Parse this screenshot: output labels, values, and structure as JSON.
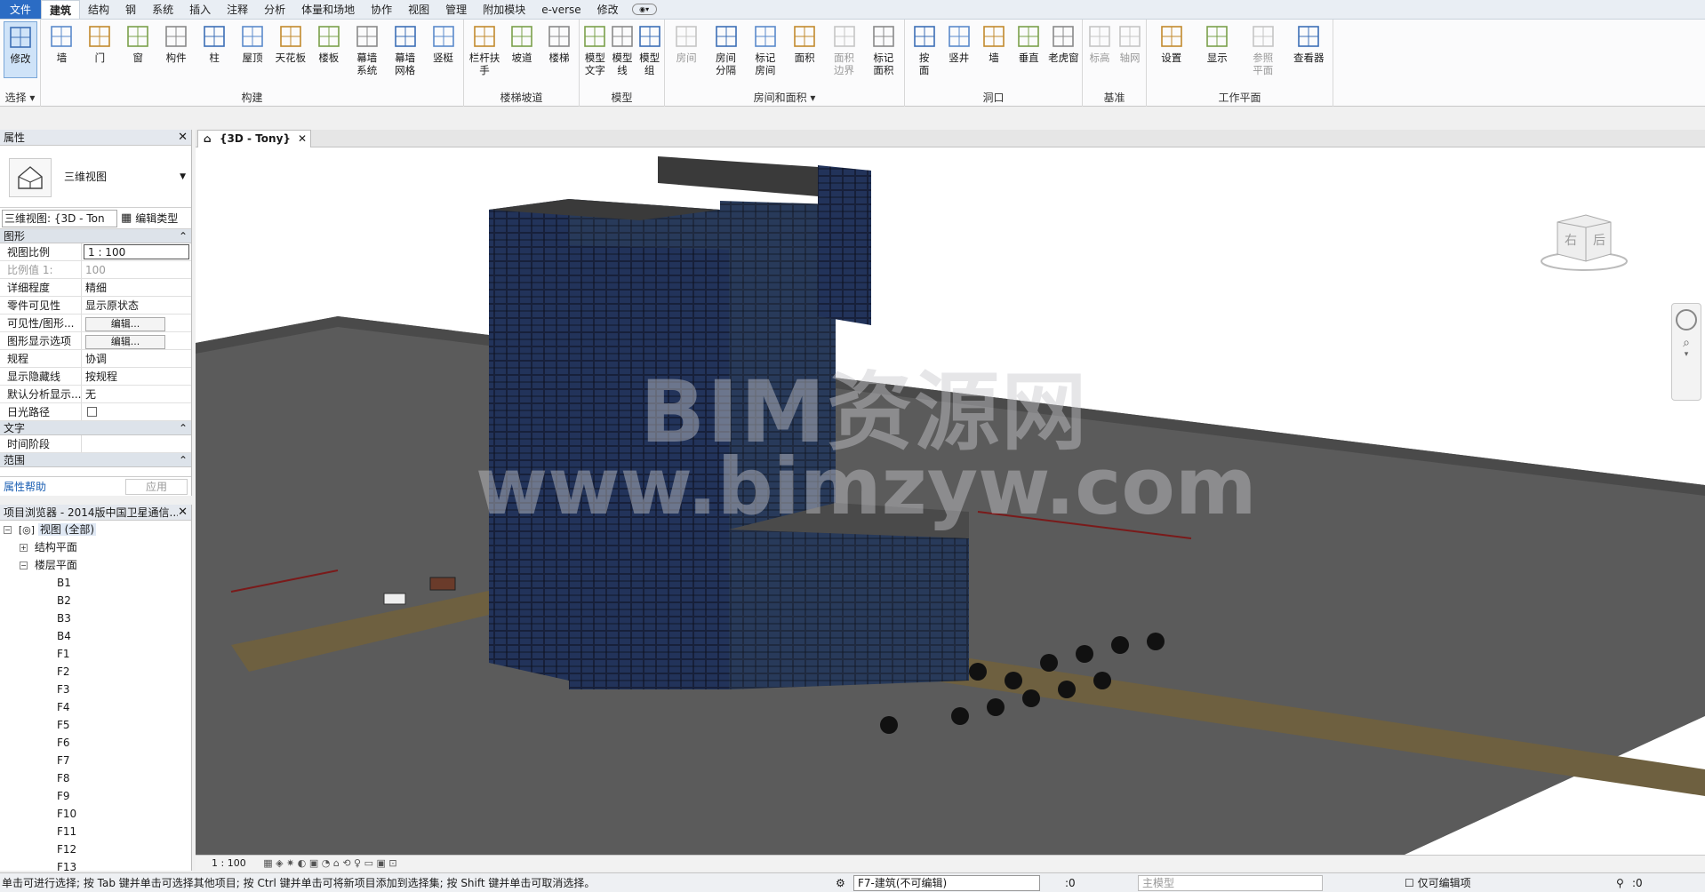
{
  "menu": {
    "tabs": [
      "文件",
      "建筑",
      "结构",
      "钢",
      "系统",
      "插入",
      "注释",
      "分析",
      "体量和场地",
      "协作",
      "视图",
      "管理",
      "附加模块",
      "e-verse",
      "修改"
    ],
    "active": "建筑"
  },
  "ribbon": {
    "panels": [
      {
        "label": "选择 ▾",
        "buttons": [
          {
            "label": "修改"
          }
        ]
      },
      {
        "label": "构建",
        "buttons": [
          {
            "label": "墙"
          },
          {
            "label": "门"
          },
          {
            "label": "窗"
          },
          {
            "label": "构件"
          },
          {
            "label": "柱"
          },
          {
            "label": "屋顶"
          },
          {
            "label": "天花板"
          },
          {
            "label": "楼板"
          },
          {
            "label": "幕墙\n系统"
          },
          {
            "label": "幕墙\n网格"
          },
          {
            "label": "竖梃"
          }
        ]
      },
      {
        "label": "楼梯坡道",
        "buttons": [
          {
            "label": "栏杆扶手"
          },
          {
            "label": "坡道"
          },
          {
            "label": "楼梯"
          }
        ]
      },
      {
        "label": "模型",
        "buttons": [
          {
            "label": "模型\n文字"
          },
          {
            "label": "模型\n线"
          },
          {
            "label": "模型\n组"
          }
        ]
      },
      {
        "label": "房间和面积 ▾",
        "buttons": [
          {
            "label": "房间"
          },
          {
            "label": "房间\n分隔"
          },
          {
            "label": "标记\n房间"
          },
          {
            "label": "面积"
          },
          {
            "label": "面积\n边界"
          },
          {
            "label": "标记\n面积"
          }
        ]
      },
      {
        "label": "洞口",
        "buttons": [
          {
            "label": "按\n面"
          },
          {
            "label": "竖井"
          },
          {
            "label": "墙"
          },
          {
            "label": "垂直"
          },
          {
            "label": "老虎窗"
          }
        ]
      },
      {
        "label": "基准",
        "buttons": [
          {
            "label": "标高"
          },
          {
            "label": "轴网"
          }
        ]
      },
      {
        "label": "工作平面",
        "buttons": [
          {
            "label": "设置"
          },
          {
            "label": "显示"
          },
          {
            "label": "参照\n平面"
          },
          {
            "label": "查看器"
          }
        ]
      }
    ]
  },
  "properties": {
    "title": "属性",
    "type_name": "三维视图",
    "selector_value": "三维视图: {3D - Ton",
    "edit_type": "编辑类型",
    "group_graphics": "图形",
    "rows": [
      {
        "k": "视图比例",
        "v": "1 : 100"
      },
      {
        "k": "比例值 1:",
        "v": "100"
      },
      {
        "k": "详细程度",
        "v": "精细"
      },
      {
        "k": "零件可见性",
        "v": "显示原状态"
      },
      {
        "k": "可见性/图形...",
        "v": "编辑..."
      },
      {
        "k": "图形显示选项",
        "v": "编辑..."
      },
      {
        "k": "规程",
        "v": "协调"
      },
      {
        "k": "显示隐藏线",
        "v": "按规程"
      },
      {
        "k": "默认分析显示...",
        "v": "无"
      },
      {
        "k": "日光路径",
        "v": ""
      }
    ],
    "group_text": "文字",
    "row_phase": {
      "k": "时间阶段",
      "v": ""
    },
    "group_range": "范围",
    "help": "属性帮助",
    "apply": "应用"
  },
  "browser": {
    "title": "项目浏览器 - 2014版中国卫星通信...",
    "root": "视图 (全部)",
    "structural": "结构平面",
    "floor": "楼层平面",
    "levels": [
      "B1",
      "B2",
      "B3",
      "B4",
      "F1",
      "F2",
      "F3",
      "F4",
      "F5",
      "F6",
      "F7",
      "F8",
      "F9",
      "F10",
      "F11",
      "F12",
      "F13"
    ]
  },
  "view": {
    "tab_title": "{3D - Tony}",
    "scale": "1 : 100",
    "watermark_line1": "BIM资源网",
    "watermark_line2": "www.bimzyw.com",
    "cube_right": "右",
    "cube_back": "后"
  },
  "status": {
    "hint": "单击可进行选择; 按 Tab 键并单击可选择其他项目; 按 Ctrl 键并单击可将新项目添加到选择集; 按 Shift 键并单击可取消选择。",
    "workset": "F7-建筑(不可编辑)",
    "count": ":0",
    "model": "主模型",
    "editable_only": "仅可编辑项",
    "filter_count": ":0"
  }
}
